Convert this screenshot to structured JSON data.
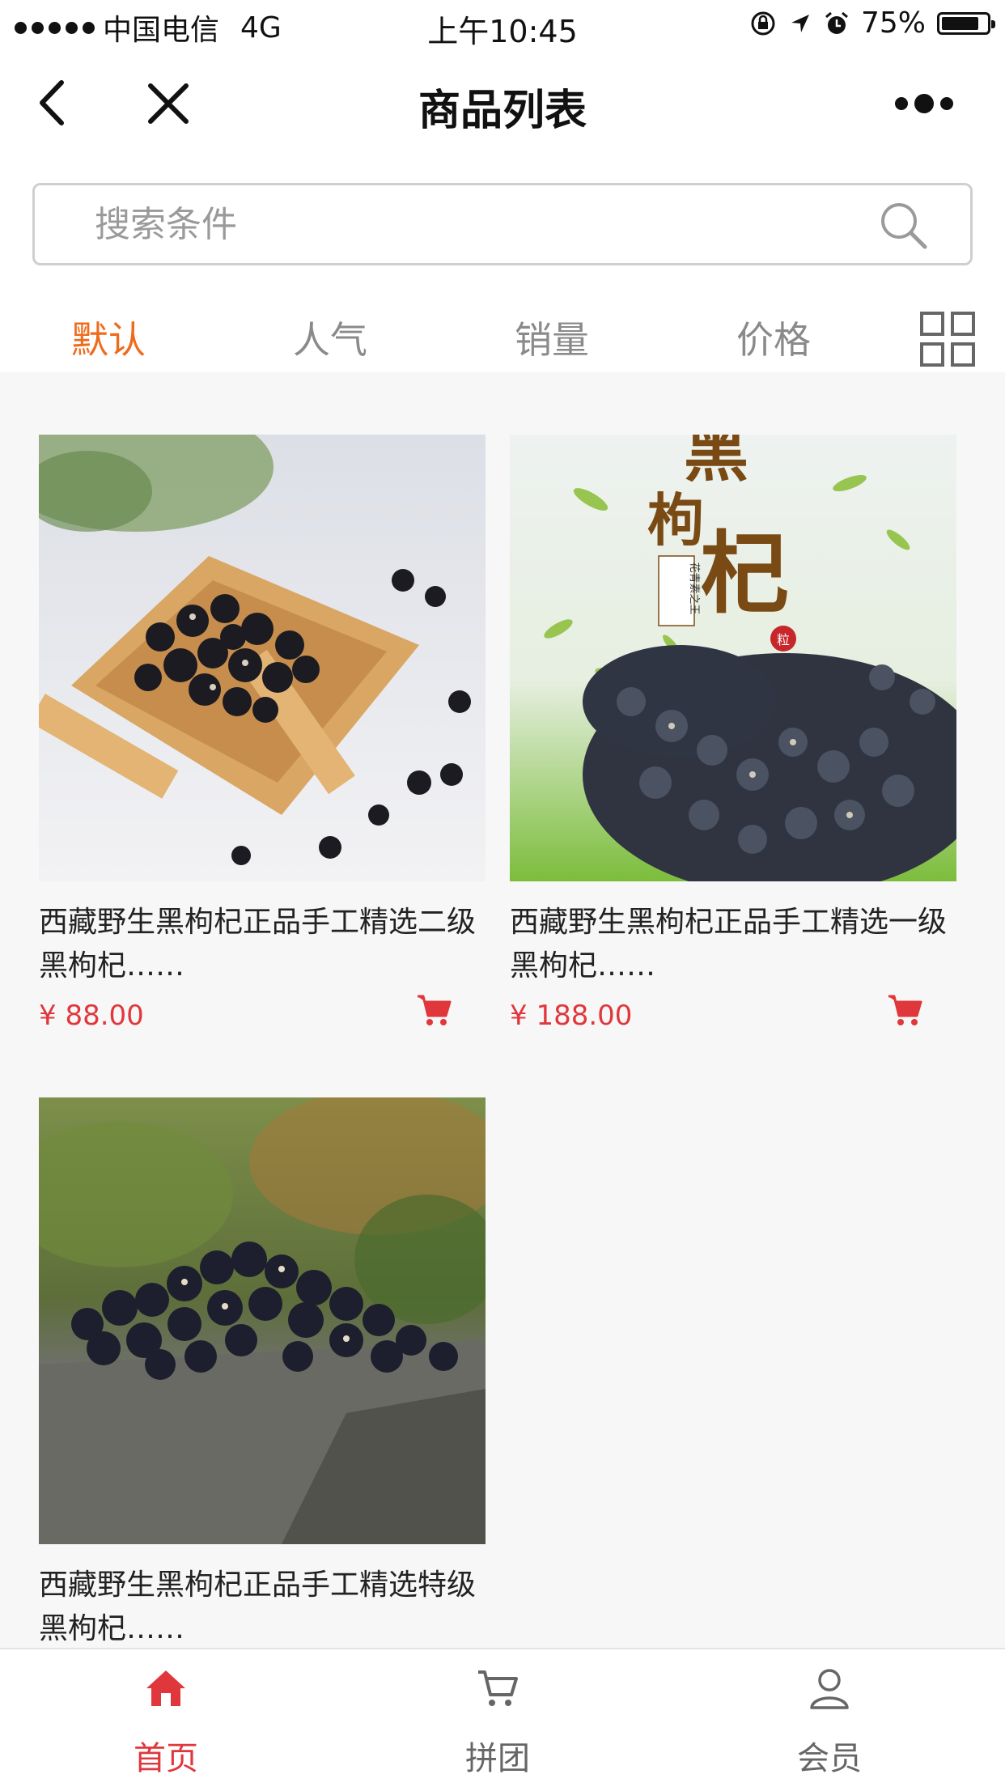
{
  "status_bar": {
    "carrier": "中国电信",
    "network": "4G",
    "time": "上午10:45",
    "battery": "75%"
  },
  "nav": {
    "title": "商品列表",
    "back_icon": "back-arrow-icon",
    "close_icon": "close-icon",
    "more_icon": "more-icon"
  },
  "search": {
    "placeholder": "搜索条件",
    "icon": "search-icon"
  },
  "sort_tabs": [
    {
      "label": "默认",
      "active": true
    },
    {
      "label": "人气",
      "active": false
    },
    {
      "label": "销量",
      "active": false
    },
    {
      "label": "价格",
      "active": false
    }
  ],
  "products": [
    {
      "name": "西藏野生黑枸杞正品手工精选二级黑枸杞……",
      "price": "¥ 88.00"
    },
    {
      "name": "西藏野生黑枸杞正品手工精选一级黑枸杞……",
      "price": "¥ 188.00",
      "image_text": {
        "line1": "黑",
        "line2": "枸",
        "line3": "杞",
        "badge": "花青素之王",
        "seal": "粒"
      }
    },
    {
      "name": "西藏野生黑枸杞正品手工精选特级黑枸杞……"
    }
  ],
  "tab_bar": [
    {
      "label": "首页",
      "icon": "home-icon",
      "active": true
    },
    {
      "label": "拼团",
      "icon": "cart-icon",
      "active": false
    },
    {
      "label": "会员",
      "icon": "user-icon",
      "active": false
    }
  ],
  "colors": {
    "accent": "#ef6b1c",
    "price": "#e0373c",
    "tab_active": "#e0373c"
  }
}
